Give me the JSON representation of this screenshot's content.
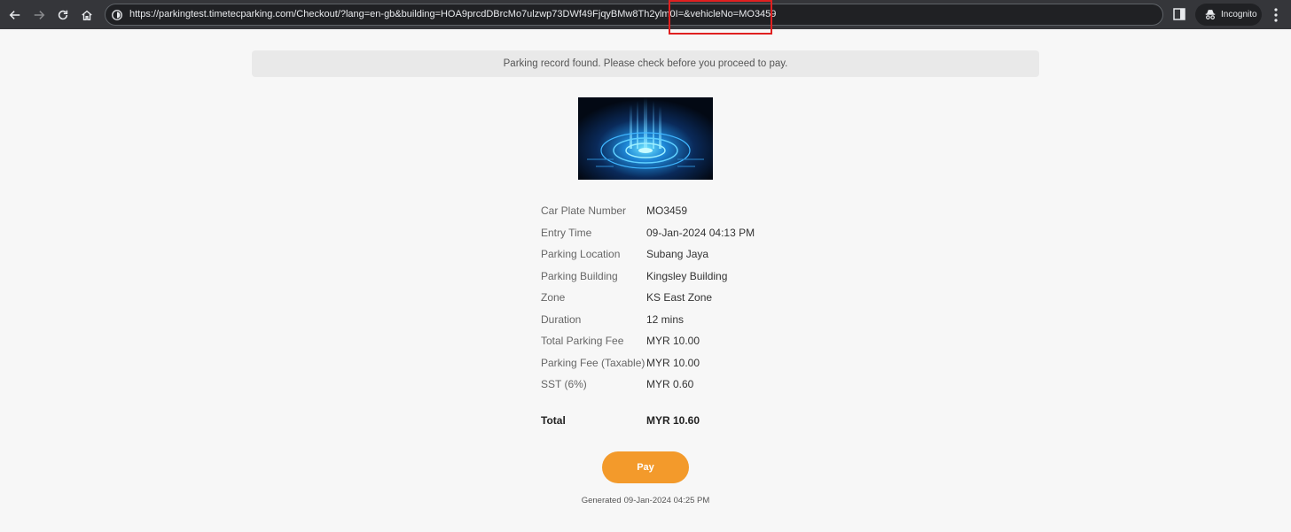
{
  "browser": {
    "url": "https://parkingtest.timetecparking.com/Checkout/?lang=en-gb&building=HOA9prcdDBrcMo7ulzwp73DWf49FjqyBMw8Th2ylm0I=&vehicleNo=MO3459",
    "incognito_label": "Incognito"
  },
  "banner": {
    "message": "Parking record found. Please check before you proceed to pay."
  },
  "details": [
    {
      "label": "Car Plate Number",
      "value": "MO3459"
    },
    {
      "label": "Entry Time",
      "value": "09-Jan-2024 04:13 PM"
    },
    {
      "label": "Parking Location",
      "value": "Subang Jaya"
    },
    {
      "label": "Parking Building",
      "value": "Kingsley Building"
    },
    {
      "label": "Zone",
      "value": "KS East Zone"
    },
    {
      "label": "Duration",
      "value": "12 mins"
    },
    {
      "label": "Total Parking Fee",
      "value": "MYR 10.00"
    },
    {
      "label": "Parking Fee (Taxable)",
      "value": "MYR 10.00"
    },
    {
      "label": "SST (6%)",
      "value": "MYR 0.60"
    }
  ],
  "total": {
    "label": "Total",
    "value": "MYR 10.60"
  },
  "pay_button": {
    "label": "Pay"
  },
  "footer": {
    "generated_label": "Generated",
    "generated_time": "09-Jan-2024 04:25 PM"
  },
  "colors": {
    "accent": "#f39a2b",
    "chrome": "#35363a",
    "highlight": "#e02020"
  }
}
